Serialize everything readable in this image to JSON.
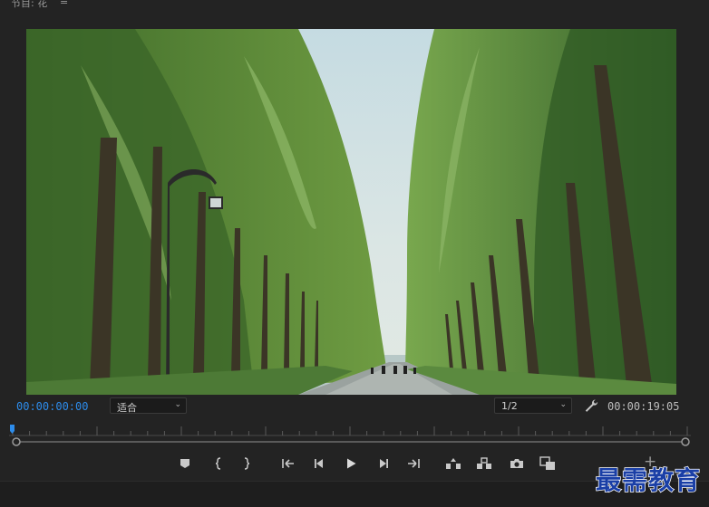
{
  "panel": {
    "title": "节目: 花",
    "menu_icon": "hamburger-icon"
  },
  "video": {
    "subject": "tree-lined-avenue-frame"
  },
  "transport": {
    "current_timecode": "00:00:00:00",
    "fit_label": "适合",
    "resolution_label": "1/2",
    "total_timecode": "00:00:19:05",
    "playhead_fraction": 0
  },
  "controls": [
    {
      "name": "add-marker-button",
      "icon": "marker-icon"
    },
    {
      "name": "mark-in-button",
      "icon": "mark-in-icon"
    },
    {
      "name": "mark-out-button",
      "icon": "mark-out-icon"
    },
    {
      "name": "go-to-in-button",
      "icon": "go-to-in-icon"
    },
    {
      "name": "step-back-button",
      "icon": "step-back-icon"
    },
    {
      "name": "play-button",
      "icon": "play-icon"
    },
    {
      "name": "step-forward-button",
      "icon": "step-forward-icon"
    },
    {
      "name": "go-to-out-button",
      "icon": "go-to-out-icon"
    },
    {
      "name": "lift-button",
      "icon": "lift-icon"
    },
    {
      "name": "extract-button",
      "icon": "extract-icon"
    },
    {
      "name": "export-frame-button",
      "icon": "camera-icon"
    },
    {
      "name": "compare-view-button",
      "icon": "compare-view-icon"
    }
  ],
  "add_button_icon": "plus-icon",
  "watermark": "最需教育",
  "colors": {
    "accent": "#2d8ceb",
    "background": "#232323",
    "watermark": "#1a3fa6"
  }
}
